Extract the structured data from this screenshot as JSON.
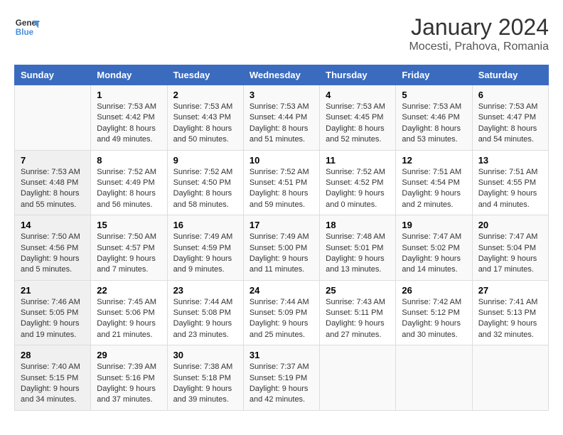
{
  "header": {
    "logo_line1": "General",
    "logo_line2": "Blue",
    "month_year": "January 2024",
    "location": "Mocesti, Prahova, Romania"
  },
  "columns": [
    "Sunday",
    "Monday",
    "Tuesday",
    "Wednesday",
    "Thursday",
    "Friday",
    "Saturday"
  ],
  "weeks": [
    [
      {
        "day": "",
        "sunrise": "",
        "sunset": "",
        "daylight": ""
      },
      {
        "day": "1",
        "sunrise": "Sunrise: 7:53 AM",
        "sunset": "Sunset: 4:42 PM",
        "daylight": "Daylight: 8 hours and 49 minutes."
      },
      {
        "day": "2",
        "sunrise": "Sunrise: 7:53 AM",
        "sunset": "Sunset: 4:43 PM",
        "daylight": "Daylight: 8 hours and 50 minutes."
      },
      {
        "day": "3",
        "sunrise": "Sunrise: 7:53 AM",
        "sunset": "Sunset: 4:44 PM",
        "daylight": "Daylight: 8 hours and 51 minutes."
      },
      {
        "day": "4",
        "sunrise": "Sunrise: 7:53 AM",
        "sunset": "Sunset: 4:45 PM",
        "daylight": "Daylight: 8 hours and 52 minutes."
      },
      {
        "day": "5",
        "sunrise": "Sunrise: 7:53 AM",
        "sunset": "Sunset: 4:46 PM",
        "daylight": "Daylight: 8 hours and 53 minutes."
      },
      {
        "day": "6",
        "sunrise": "Sunrise: 7:53 AM",
        "sunset": "Sunset: 4:47 PM",
        "daylight": "Daylight: 8 hours and 54 minutes."
      }
    ],
    [
      {
        "day": "7",
        "sunrise": "Sunrise: 7:53 AM",
        "sunset": "Sunset: 4:48 PM",
        "daylight": "Daylight: 8 hours and 55 minutes."
      },
      {
        "day": "8",
        "sunrise": "Sunrise: 7:52 AM",
        "sunset": "Sunset: 4:49 PM",
        "daylight": "Daylight: 8 hours and 56 minutes."
      },
      {
        "day": "9",
        "sunrise": "Sunrise: 7:52 AM",
        "sunset": "Sunset: 4:50 PM",
        "daylight": "Daylight: 8 hours and 58 minutes."
      },
      {
        "day": "10",
        "sunrise": "Sunrise: 7:52 AM",
        "sunset": "Sunset: 4:51 PM",
        "daylight": "Daylight: 8 hours and 59 minutes."
      },
      {
        "day": "11",
        "sunrise": "Sunrise: 7:52 AM",
        "sunset": "Sunset: 4:52 PM",
        "daylight": "Daylight: 9 hours and 0 minutes."
      },
      {
        "day": "12",
        "sunrise": "Sunrise: 7:51 AM",
        "sunset": "Sunset: 4:54 PM",
        "daylight": "Daylight: 9 hours and 2 minutes."
      },
      {
        "day": "13",
        "sunrise": "Sunrise: 7:51 AM",
        "sunset": "Sunset: 4:55 PM",
        "daylight": "Daylight: 9 hours and 4 minutes."
      }
    ],
    [
      {
        "day": "14",
        "sunrise": "Sunrise: 7:50 AM",
        "sunset": "Sunset: 4:56 PM",
        "daylight": "Daylight: 9 hours and 5 minutes."
      },
      {
        "day": "15",
        "sunrise": "Sunrise: 7:50 AM",
        "sunset": "Sunset: 4:57 PM",
        "daylight": "Daylight: 9 hours and 7 minutes."
      },
      {
        "day": "16",
        "sunrise": "Sunrise: 7:49 AM",
        "sunset": "Sunset: 4:59 PM",
        "daylight": "Daylight: 9 hours and 9 minutes."
      },
      {
        "day": "17",
        "sunrise": "Sunrise: 7:49 AM",
        "sunset": "Sunset: 5:00 PM",
        "daylight": "Daylight: 9 hours and 11 minutes."
      },
      {
        "day": "18",
        "sunrise": "Sunrise: 7:48 AM",
        "sunset": "Sunset: 5:01 PM",
        "daylight": "Daylight: 9 hours and 13 minutes."
      },
      {
        "day": "19",
        "sunrise": "Sunrise: 7:47 AM",
        "sunset": "Sunset: 5:02 PM",
        "daylight": "Daylight: 9 hours and 14 minutes."
      },
      {
        "day": "20",
        "sunrise": "Sunrise: 7:47 AM",
        "sunset": "Sunset: 5:04 PM",
        "daylight": "Daylight: 9 hours and 17 minutes."
      }
    ],
    [
      {
        "day": "21",
        "sunrise": "Sunrise: 7:46 AM",
        "sunset": "Sunset: 5:05 PM",
        "daylight": "Daylight: 9 hours and 19 minutes."
      },
      {
        "day": "22",
        "sunrise": "Sunrise: 7:45 AM",
        "sunset": "Sunset: 5:06 PM",
        "daylight": "Daylight: 9 hours and 21 minutes."
      },
      {
        "day": "23",
        "sunrise": "Sunrise: 7:44 AM",
        "sunset": "Sunset: 5:08 PM",
        "daylight": "Daylight: 9 hours and 23 minutes."
      },
      {
        "day": "24",
        "sunrise": "Sunrise: 7:44 AM",
        "sunset": "Sunset: 5:09 PM",
        "daylight": "Daylight: 9 hours and 25 minutes."
      },
      {
        "day": "25",
        "sunrise": "Sunrise: 7:43 AM",
        "sunset": "Sunset: 5:11 PM",
        "daylight": "Daylight: 9 hours and 27 minutes."
      },
      {
        "day": "26",
        "sunrise": "Sunrise: 7:42 AM",
        "sunset": "Sunset: 5:12 PM",
        "daylight": "Daylight: 9 hours and 30 minutes."
      },
      {
        "day": "27",
        "sunrise": "Sunrise: 7:41 AM",
        "sunset": "Sunset: 5:13 PM",
        "daylight": "Daylight: 9 hours and 32 minutes."
      }
    ],
    [
      {
        "day": "28",
        "sunrise": "Sunrise: 7:40 AM",
        "sunset": "Sunset: 5:15 PM",
        "daylight": "Daylight: 9 hours and 34 minutes."
      },
      {
        "day": "29",
        "sunrise": "Sunrise: 7:39 AM",
        "sunset": "Sunset: 5:16 PM",
        "daylight": "Daylight: 9 hours and 37 minutes."
      },
      {
        "day": "30",
        "sunrise": "Sunrise: 7:38 AM",
        "sunset": "Sunset: 5:18 PM",
        "daylight": "Daylight: 9 hours and 39 minutes."
      },
      {
        "day": "31",
        "sunrise": "Sunrise: 7:37 AM",
        "sunset": "Sunset: 5:19 PM",
        "daylight": "Daylight: 9 hours and 42 minutes."
      },
      {
        "day": "",
        "sunrise": "",
        "sunset": "",
        "daylight": ""
      },
      {
        "day": "",
        "sunrise": "",
        "sunset": "",
        "daylight": ""
      },
      {
        "day": "",
        "sunrise": "",
        "sunset": "",
        "daylight": ""
      }
    ]
  ]
}
